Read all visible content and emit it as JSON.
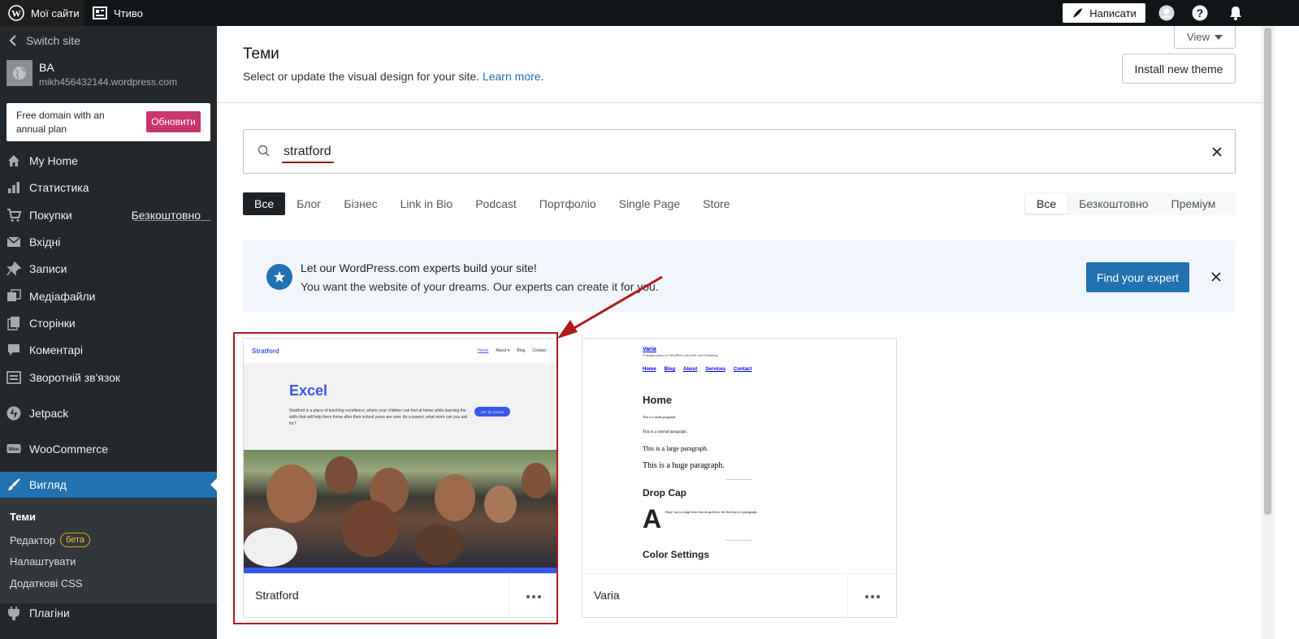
{
  "topbar": {
    "my_sites": "Мої сайти",
    "reader": "Чтиво",
    "write": "Написати"
  },
  "sidebar": {
    "switch_site": "Switch site",
    "site_name": "BA",
    "site_url": "mikh456432144.wordpress.com",
    "promo_text": "Free domain with an annual plan",
    "promo_button": "Обновити",
    "items": [
      {
        "label": "My Home",
        "icon": "house-icon"
      },
      {
        "label": "Статистика",
        "icon": "stats-icon"
      },
      {
        "label": "Покупки",
        "icon": "cart-icon",
        "extra": "Безкоштовно"
      },
      {
        "label": "Вхідні",
        "icon": "mail-icon"
      },
      {
        "label": "Записи",
        "icon": "pin-icon"
      },
      {
        "label": "Медіафайли",
        "icon": "media-icon"
      },
      {
        "label": "Сторінки",
        "icon": "pages-icon"
      },
      {
        "label": "Коментарі",
        "icon": "comment-icon"
      },
      {
        "label": "Зворотній зв'язок",
        "icon": "feedback-icon"
      },
      {
        "label": "Jetpack",
        "icon": "jetpack-icon"
      },
      {
        "label": "WooCommerce",
        "icon": "woo-icon"
      },
      {
        "label": "Вигляд",
        "icon": "brush-icon"
      },
      {
        "label": "Плагіни",
        "icon": "plugin-icon"
      }
    ],
    "submenu": {
      "themes": "Теми",
      "editor": "Редактор",
      "editor_badge": "бета",
      "customize": "Налаштувати",
      "css": "Додаткові CSS"
    }
  },
  "header": {
    "title": "Теми",
    "subtitle": "Select or update the visual design for your site.",
    "learn_more": "Learn more",
    "view": "View",
    "install": "Install new theme"
  },
  "search": {
    "value": "stratford"
  },
  "categories": [
    "Все",
    "Блог",
    "Бізнес",
    "Link in Bio",
    "Podcast",
    "Портфоліо",
    "Single Page",
    "Store"
  ],
  "tiers": [
    "Все",
    "Безкоштовно",
    "Преміум"
  ],
  "banner": {
    "title": "Let our WordPress.com experts build your site!",
    "text": "You want the website of your dreams. Our experts can create it for you.",
    "button": "Find your expert"
  },
  "themes": [
    {
      "name": "Stratford",
      "preview": {
        "logo": "Stratford",
        "nav": [
          "Home",
          "About ▾",
          "Blog",
          "Contact"
        ],
        "headline": "Excel",
        "body": "Stratford is a place of teaching excellence, where your children can feel at home while learning the skills that will help them thrive after their school years are over. As a parent, what more can you ask for?",
        "cta": "GET IN TOUCH"
      }
    },
    {
      "name": "Varia",
      "preview": {
        "site_title": "Varia",
        "tagline": "A design system for WordPress sites built with Gutenberg",
        "nav": [
          "Home",
          "Blog",
          "About",
          "Services",
          "Contact"
        ],
        "h_home": "Home",
        "small": "This is a small paragraph.",
        "normal": "This is a normal paragraph.",
        "large": "This is a large paragraph.",
        "huge": "This is a huge paragraph.",
        "h_dropcap": "Drop Cap",
        "drop_letter": "A",
        "drop_text": "Drop Cap is a large letter that drops below the first line of a paragraph.",
        "h_colors": "Color Settings"
      }
    }
  ],
  "colors": {
    "accent": "#2271b1",
    "sidebar": "#23282d",
    "highlight": "#b11b1b",
    "promo": "#c9356e"
  }
}
